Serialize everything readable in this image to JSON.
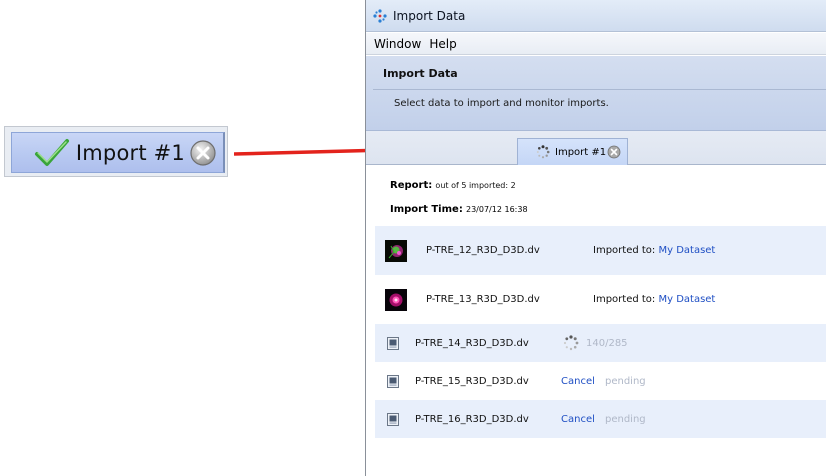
{
  "callout": {
    "label": "Import #1",
    "check_icon": "green-checkmark-icon",
    "close_icon": "close-circle-icon"
  },
  "window": {
    "title": "Import Data",
    "menu": [
      "Window",
      "Help"
    ],
    "header": {
      "title": "Import Data",
      "description": "Select data to import and monitor imports."
    },
    "tab": {
      "label": "Import #1"
    },
    "report": {
      "report_label": "Report:",
      "report_value": "out of 5 imported: 2",
      "time_label": "Import Time:",
      "time_value": "23/07/12 16:38"
    },
    "files": [
      {
        "name": "P-TRE_12_R3D_D3D.dv",
        "status_label": "Imported to:",
        "dataset": "My Dataset"
      },
      {
        "name": "P-TRE_13_R3D_D3D.dv",
        "status_label": "Imported to:",
        "dataset": "My Dataset"
      },
      {
        "name": "P-TRE_14_R3D_D3D.dv",
        "progress": "140/285"
      },
      {
        "name": "P-TRE_15_R3D_D3D.dv",
        "cancel": "Cancel",
        "state": "pending"
      },
      {
        "name": "P-TRE_16_R3D_D3D.dv",
        "cancel": "Cancel",
        "state": "pending"
      }
    ]
  },
  "colors": {
    "link": "#1f4fc4",
    "arrow": "#e3231c",
    "header_bg": "#c8d4ec",
    "tab_bg": "#c9daf8"
  }
}
